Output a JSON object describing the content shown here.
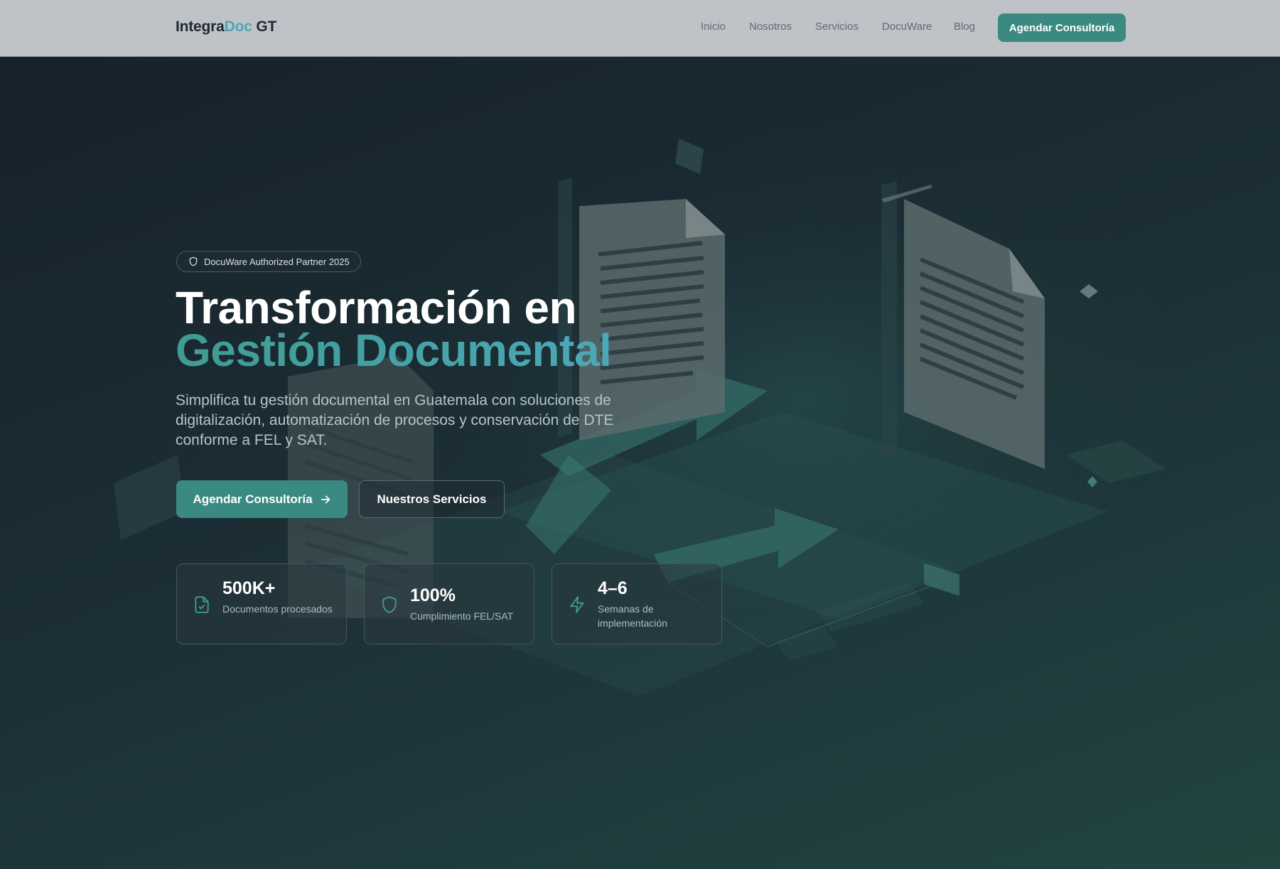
{
  "nav": {
    "logo_part1": "Integra",
    "logo_part2": "Doc",
    "logo_part3": " GT",
    "links": [
      "Inicio",
      "Nosotros",
      "Servicios",
      "DocuWare",
      "Blog"
    ],
    "cta_label": "Agendar Consultoría"
  },
  "hero": {
    "badge": "DocuWare Authorized Partner 2025",
    "title_line1": "Transformación en",
    "title_line2": "Gestión Documental",
    "subtitle": "Simplifica tu gestión documental en Guatemala con soluciones de digitalización, automatización de procesos y conservación de DTE conforme a FEL y SAT.",
    "primary_button": "Agendar Consultoría",
    "secondary_button": "Nuestros Servicios",
    "stats": [
      {
        "icon": "file-check-icon",
        "value": "500K+",
        "label": "Documentos procesados"
      },
      {
        "icon": "shield-icon",
        "value": "100%",
        "label": "Cumplimiento FEL/SAT"
      },
      {
        "icon": "lightning-icon",
        "value": "4–6",
        "label": "Semanas de implementación"
      }
    ]
  },
  "colors": {
    "accent": "#3a8a82",
    "accent_light": "#4aa7b4",
    "navbar_bg": "#bfc3c7",
    "hero_bg": "#1b2c33"
  }
}
